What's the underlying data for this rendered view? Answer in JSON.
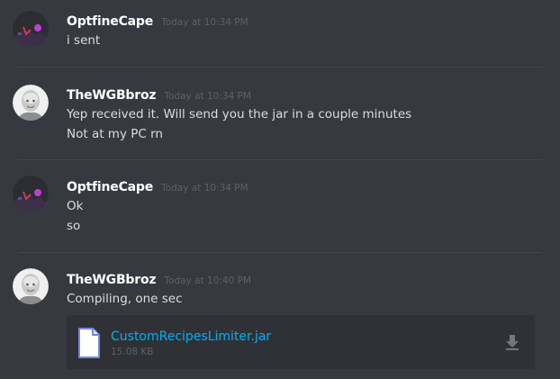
{
  "messages": [
    {
      "username": "OptfineCape",
      "timestamp": "Today at 10:34 PM",
      "avatar": "optfinecape-avatar",
      "lines": [
        "i sent"
      ]
    },
    {
      "username": "TheWGBbroz",
      "timestamp": "Today at 10:34 PM",
      "avatar": "thewgbbroz-avatar",
      "lines": [
        "Yep received it. Will send you the jar in a couple minutes",
        "Not at my PC rn"
      ]
    },
    {
      "username": "OptfineCape",
      "timestamp": "Today at 10:34 PM",
      "avatar": "optfinecape-avatar",
      "lines": [
        "Ok",
        "so"
      ]
    },
    {
      "username": "TheWGBbroz",
      "timestamp": "Today at 10:40 PM",
      "avatar": "thewgbbroz-avatar",
      "lines": [
        "Compiling, one sec"
      ],
      "attachment": {
        "file_name": "CustomRecipesLimiter.jar",
        "file_size": "15.08 KB",
        "icon": "file-icon",
        "action_icon": "download-icon"
      }
    }
  ],
  "colors": {
    "background": "#36393f",
    "username": "#ffffff",
    "message_text": "#dcddde",
    "timestamp": "#5d6067",
    "link": "#00b0f4",
    "attachment_bg": "#2f3136"
  }
}
